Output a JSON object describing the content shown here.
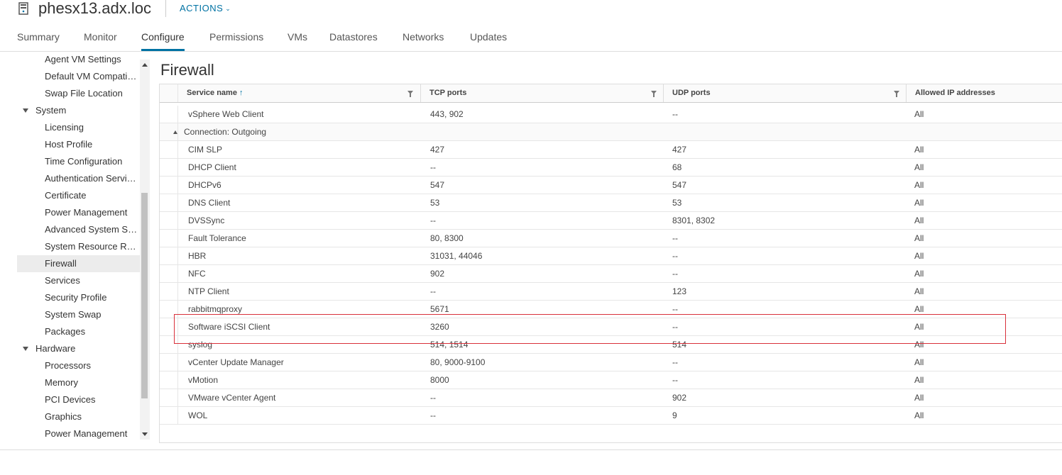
{
  "header": {
    "host_name": "phesx13.adx.loc",
    "actions_label": "ACTIONS"
  },
  "tabs": [
    {
      "label": "Summary",
      "active": false
    },
    {
      "label": "Monitor",
      "active": false
    },
    {
      "label": "Configure",
      "active": true
    },
    {
      "label": "Permissions",
      "active": false
    },
    {
      "label": "VMs",
      "active": false
    },
    {
      "label": "Datastores",
      "active": false
    },
    {
      "label": "Networks",
      "active": false
    },
    {
      "label": "Updates",
      "active": false
    }
  ],
  "sidebar": {
    "items": [
      {
        "label": "Agent VM Settings",
        "level": "child"
      },
      {
        "label": "Default VM Compatibility",
        "level": "child"
      },
      {
        "label": "Swap File Location",
        "level": "child"
      },
      {
        "label": "System",
        "level": "parent"
      },
      {
        "label": "Licensing",
        "level": "child"
      },
      {
        "label": "Host Profile",
        "level": "child"
      },
      {
        "label": "Time Configuration",
        "level": "child"
      },
      {
        "label": "Authentication Services",
        "level": "child"
      },
      {
        "label": "Certificate",
        "level": "child"
      },
      {
        "label": "Power Management",
        "level": "child"
      },
      {
        "label": "Advanced System Settings",
        "level": "child"
      },
      {
        "label": "System Resource Reservation",
        "level": "child"
      },
      {
        "label": "Firewall",
        "level": "child",
        "selected": true
      },
      {
        "label": "Services",
        "level": "child"
      },
      {
        "label": "Security Profile",
        "level": "child"
      },
      {
        "label": "System Swap",
        "level": "child"
      },
      {
        "label": "Packages",
        "level": "child"
      },
      {
        "label": "Hardware",
        "level": "parent"
      },
      {
        "label": "Processors",
        "level": "child"
      },
      {
        "label": "Memory",
        "level": "child"
      },
      {
        "label": "PCI Devices",
        "level": "child"
      },
      {
        "label": "Graphics",
        "level": "child"
      },
      {
        "label": "Power Management",
        "level": "child"
      }
    ]
  },
  "main": {
    "title": "Firewall",
    "columns": {
      "service_name": "Service name",
      "tcp_ports": "TCP ports",
      "udp_ports": "UDP ports",
      "allowed_ip": "Allowed IP addresses"
    },
    "rows": [
      {
        "type": "row",
        "service": "vSphere Web Client",
        "tcp": "443, 902",
        "udp": "--",
        "ip": "All"
      },
      {
        "type": "group",
        "label": "Connection: Outgoing"
      },
      {
        "type": "row",
        "service": "CIM SLP",
        "tcp": "427",
        "udp": "427",
        "ip": "All"
      },
      {
        "type": "row",
        "service": "DHCP Client",
        "tcp": "--",
        "udp": "68",
        "ip": "All"
      },
      {
        "type": "row",
        "service": "DHCPv6",
        "tcp": "547",
        "udp": "547",
        "ip": "All"
      },
      {
        "type": "row",
        "service": "DNS Client",
        "tcp": "53",
        "udp": "53",
        "ip": "All"
      },
      {
        "type": "row",
        "service": "DVSSync",
        "tcp": "--",
        "udp": "8301, 8302",
        "ip": "All"
      },
      {
        "type": "row",
        "service": "Fault Tolerance",
        "tcp": "80, 8300",
        "udp": "--",
        "ip": "All"
      },
      {
        "type": "row",
        "service": "HBR",
        "tcp": "31031, 44046",
        "udp": "--",
        "ip": "All"
      },
      {
        "type": "row",
        "service": "NFC",
        "tcp": "902",
        "udp": "--",
        "ip": "All"
      },
      {
        "type": "row",
        "service": "NTP Client",
        "tcp": "--",
        "udp": "123",
        "ip": "All"
      },
      {
        "type": "row",
        "service": "rabbitmqproxy",
        "tcp": "5671",
        "udp": "--",
        "ip": "All"
      },
      {
        "type": "row",
        "service": "Software iSCSI Client",
        "tcp": "3260",
        "udp": "--",
        "ip": "All"
      },
      {
        "type": "row",
        "service": "syslog",
        "tcp": "514, 1514",
        "udp": "514",
        "ip": "All"
      },
      {
        "type": "row",
        "service": "vCenter Update Manager",
        "tcp": "80, 9000-9100",
        "udp": "--",
        "ip": "All"
      },
      {
        "type": "row",
        "service": "vMotion",
        "tcp": "8000",
        "udp": "--",
        "ip": "All"
      },
      {
        "type": "row",
        "service": "VMware vCenter Agent",
        "tcp": "--",
        "udp": "902",
        "ip": "All"
      },
      {
        "type": "row",
        "service": "WOL",
        "tcp": "--",
        "udp": "9",
        "ip": "All"
      }
    ]
  },
  "colors": {
    "accent": "#0072a3",
    "highlight_box": "#d9303b",
    "selected_bg": "#ececec"
  }
}
